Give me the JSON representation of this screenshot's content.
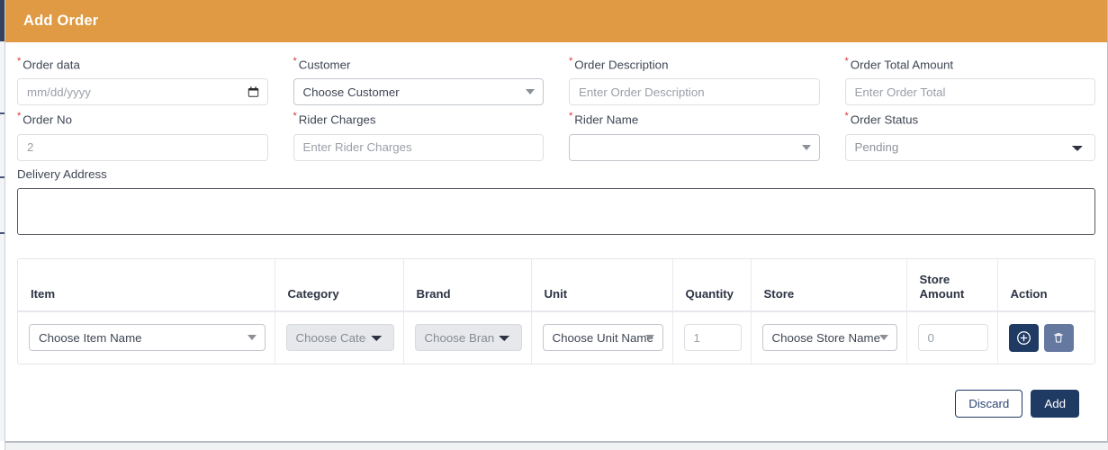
{
  "modal": {
    "title": "Add Order",
    "header_color": "#df9a43"
  },
  "fields": {
    "order_date": {
      "label": "Order data",
      "required": true,
      "placeholder": "mm/dd/yyyy",
      "value": "",
      "icon": "calendar-icon"
    },
    "customer": {
      "label": "Customer",
      "required": true,
      "value": "Choose Customer"
    },
    "order_description": {
      "label": "Order Description",
      "required": true,
      "placeholder": "Enter Order Description",
      "value": ""
    },
    "order_total_amount": {
      "label": "Order Total Amount",
      "required": true,
      "placeholder": "Enter Order Total",
      "value": ""
    },
    "order_no": {
      "label": "Order No",
      "required": true,
      "placeholder": "2",
      "value": ""
    },
    "rider_charges": {
      "label": "Rider Charges",
      "required": true,
      "placeholder": "Enter Rider Charges",
      "value": ""
    },
    "rider_name": {
      "label": "Rider Name",
      "required": true,
      "value": ""
    },
    "order_status": {
      "label": "Order Status",
      "required": true,
      "value": "Pending",
      "options": [
        "Pending"
      ]
    },
    "delivery_address": {
      "label": "Delivery Address",
      "required": false,
      "value": ""
    }
  },
  "items_table": {
    "columns": [
      "Item",
      "Category",
      "Brand",
      "Unit",
      "Quantity",
      "Store",
      "Store Amount",
      "Action"
    ],
    "rows": [
      {
        "item": "Choose Item Name",
        "category": "Choose Category",
        "brand": "Choose Brand",
        "unit": "Choose Unit Name",
        "quantity": "1",
        "store": "Choose Store Name",
        "store_amount": "0",
        "actions": {
          "add": "add-row-icon",
          "delete": "delete-row-icon"
        }
      }
    ]
  },
  "footer": {
    "discard_label": "Discard",
    "add_label": "Add"
  },
  "colors": {
    "header_orange": "#df9a43",
    "primary_navy": "#1f3a63",
    "secondary_slate": "#6478a0",
    "required_red": "#e03030"
  }
}
